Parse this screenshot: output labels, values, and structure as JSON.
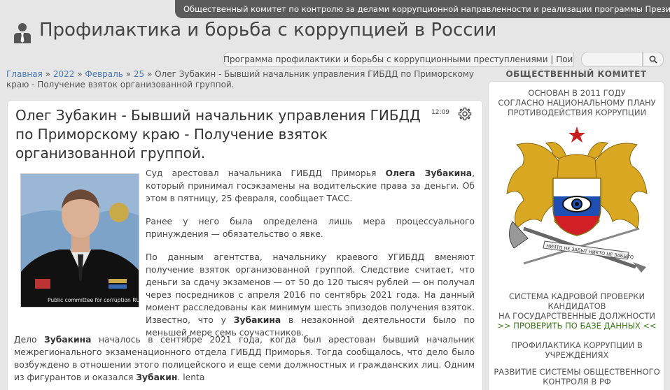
{
  "top_banner": "Общественный комитет по контролю за делами коррупционной направленности и реализации программы Президента РФ",
  "site_title": "Профилактика и борьба с коррупцией в России",
  "program_bar": "Программа профилактики и борьбы с коррупционными преступлениями | Поиск в БД:",
  "search": {
    "value": "",
    "placeholder": ""
  },
  "breadcrumb": {
    "home": "Главная",
    "sep": " » ",
    "year": "2022",
    "month": "Февраль",
    "day": "25",
    "current": "Олег Зубакин - Бывший начальник управления ГИБДД по Приморскому краю - Получение взяток организованной группой."
  },
  "article": {
    "title": "Олег Зубакин - Бывший начальник управления ГИБДД по Приморскому краю - Получение взяток организованной группой.",
    "time": "12:09",
    "photo_caption": "Public committee for corruption RUS",
    "p1_a": "Суд арестовал начальника ГИБДД Приморья ",
    "p1_b": "Олега Зубакина",
    "p1_c": ", который принимал госэкзамены на водительские права за деньги. Об этом в пятницу, 25 февраля, сообщает ТАСС.",
    "p2": "Ранее у него была определена лишь мера процессуального принуждения — обязательство о явке.",
    "p3_a": "По данным агентства, начальнику краевого УГИБДД вменяют получение взяток организованной группой. Следствие считает, что деньги за сдачу экзаменов — от 50 до 120 тысяч рублей — он получал через посредников с апреля 2016 по сентябрь 2021 года. На данный момент расследованы как минимум шесть эпизодов получения взяток. Известно, что у ",
    "p3_b": "Зубакина",
    "p3_c": " в незаконной деятельности было по меньшей мере семь соучастников.",
    "p4_a": "Дело ",
    "p4_b": "Зубакина",
    "p4_c": " началось в сентябре 2021 года, когда был арестован бывший начальник межрегионального экзаменационного отдела ГИБДД Приморья. Тогда сообщалось, что дело было возбуждено в отношении этого полицейского и еще семи должностных и гражданских лиц. Одним из фигурантов и оказался ",
    "p4_d": "Зубакин",
    "p4_e": ".  lenta"
  },
  "sidebar": {
    "heading": "ОБЩЕСТВЕННЫЙ КОМИТЕТ",
    "founded_1": "ОСНОВАН В 2011 ГОДУ",
    "founded_2": "СОГЛАСНО НАЦИОНАЛЬНОМУ ПЛАНУ",
    "founded_3": "ПРОТИВОДЕЙСТВИЯ КОРРУПЦИИ",
    "emblem_motto": "НИЧТО НЕ ЗАБЫТ НИКТО НЕ ЗАБЫТО",
    "check_1": "СИСТЕМА КАДРОВОЙ ПРОВЕРКИ",
    "check_2": "КАНДИДАТОВ",
    "check_3": "НА ГОСУДАРСТВЕННЫЕ ДОЛЖНОСТИ",
    "check_link": ">> ПРОВЕРИТЬ ПО БАЗЕ ДАННЫХ <<",
    "prev_1": "ПРОФИЛАКТИКА КОРРУПЦИИ В",
    "prev_2": "УЧРЕЖДЕНИЯХ",
    "dev_1": "РАЗВИТИЕ СИСТЕМЫ ОБЩЕСТВЕННОГО",
    "dev_2": "КОНТРОЛЯ В РФ"
  },
  "colors": {
    "banner_bg": "#5b5b5b",
    "link": "#4a7ab5",
    "sidebar_link": "#3b7a1a",
    "emblem_gold": "#d9a722",
    "flag_blue": "#1f4fb3",
    "flag_red": "#d21f26"
  }
}
